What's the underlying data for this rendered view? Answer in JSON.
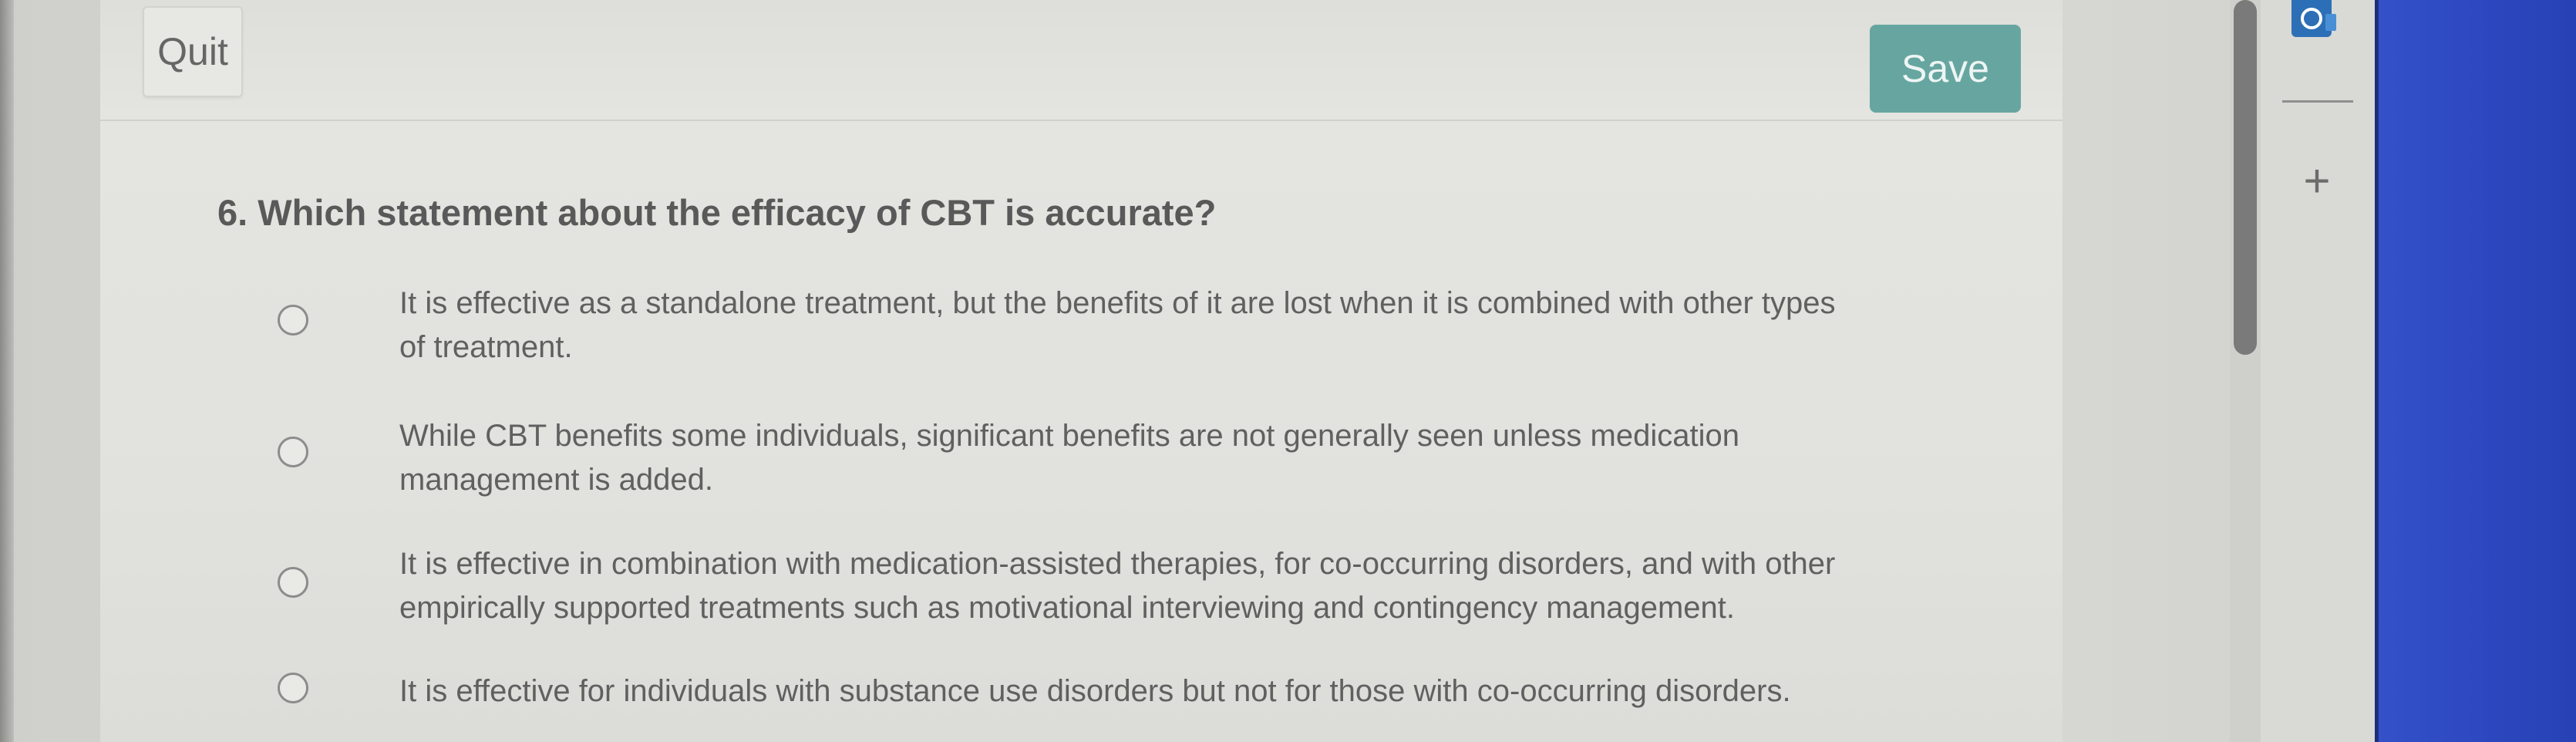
{
  "toolbar": {
    "quit_label": "Quit",
    "save_label": "Save"
  },
  "question": {
    "text": "6. Which statement about the efficacy of CBT is accurate?"
  },
  "options": [
    {
      "line1": "It is effective as a standalone treatment, but the benefits of it are lost when it is combined with other types",
      "line2": "of treatment."
    },
    {
      "line1": "While CBT benefits some individuals, significant benefits are not generally seen unless medication",
      "line2": "management is added."
    },
    {
      "line1": "It is effective in combination with medication-assisted therapies, for co-occurring disorders, and with other",
      "line2": "empirically supported treatments such as motivational interviewing and contingency management."
    },
    {
      "line1": "It is effective for individuals with substance use disorders but not for those with co-occurring disorders."
    }
  ],
  "side_panel": {
    "add_label": "+",
    "outlook_icon": "outlook-icon"
  },
  "colors": {
    "save_button": "#67a6a0",
    "side_blue": "#2d48c0"
  }
}
